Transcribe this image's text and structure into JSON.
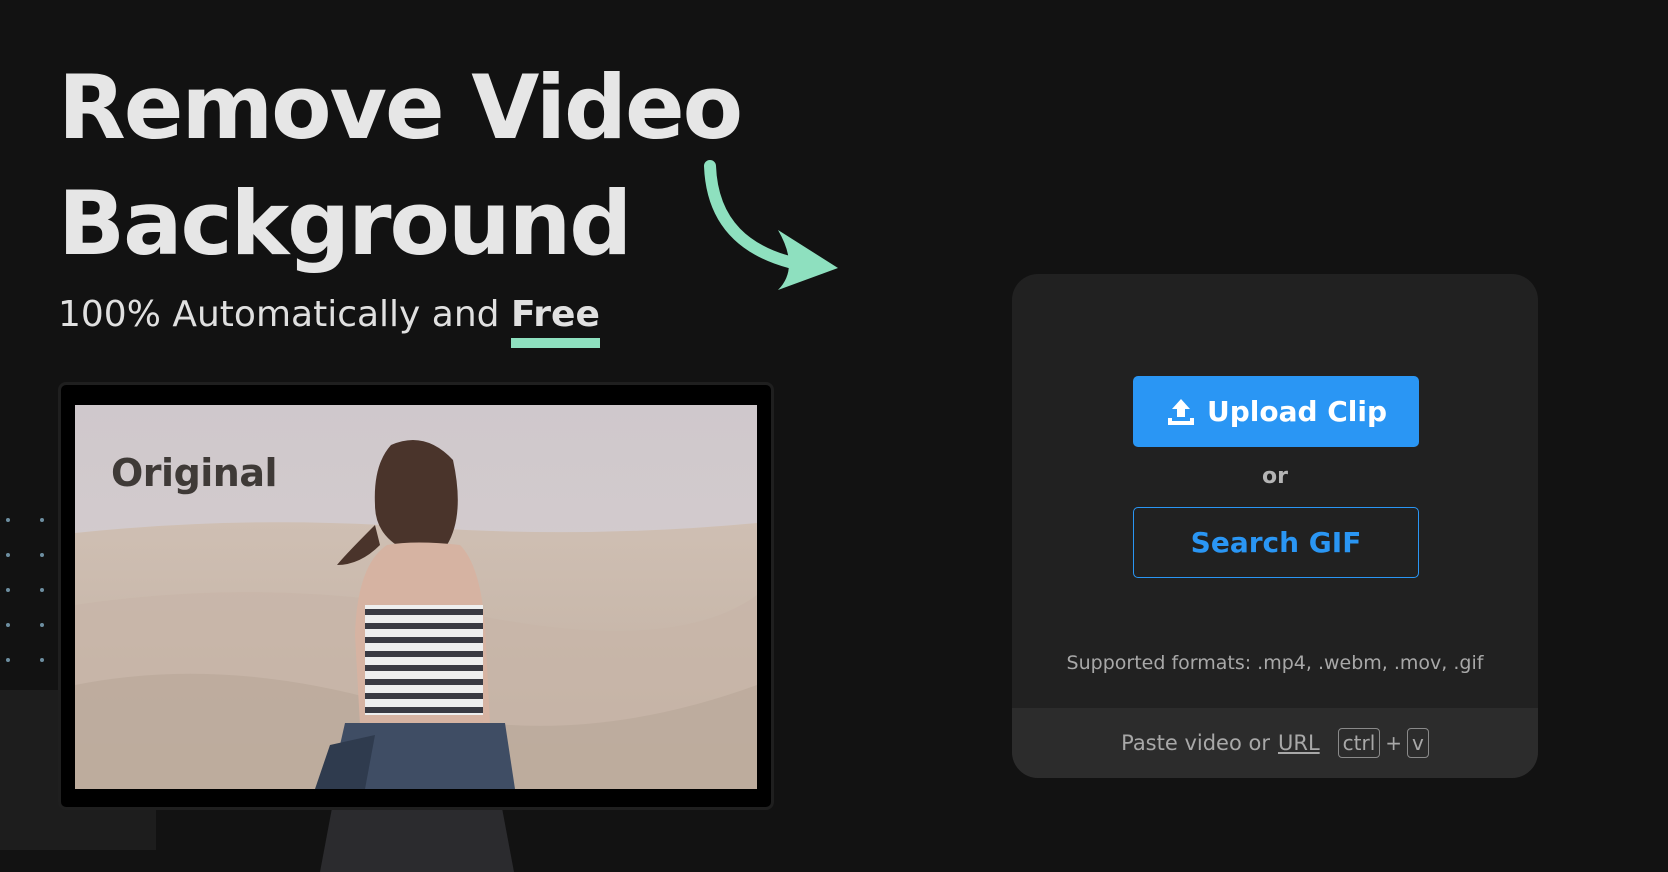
{
  "hero": {
    "title_line1": "Remove Video",
    "title_line2": "Background",
    "subtitle_prefix": "100% Automatically and",
    "subtitle_highlight": "Free",
    "accent_color": "#8ee0bf"
  },
  "preview": {
    "label": "Original"
  },
  "upload_card": {
    "upload_button_label": "Upload Clip",
    "upload_icon": "upload-icon",
    "or_text": "or",
    "search_gif_label": "Search GIF",
    "supported_formats": "Supported formats: .mp4, .webm, .mov, .gif",
    "paste_text": "Paste video or",
    "url_link": "URL",
    "shortcut_key1": "ctrl",
    "shortcut_plus": "+",
    "shortcut_key2": "v",
    "primary_color": "#2a96f4"
  }
}
